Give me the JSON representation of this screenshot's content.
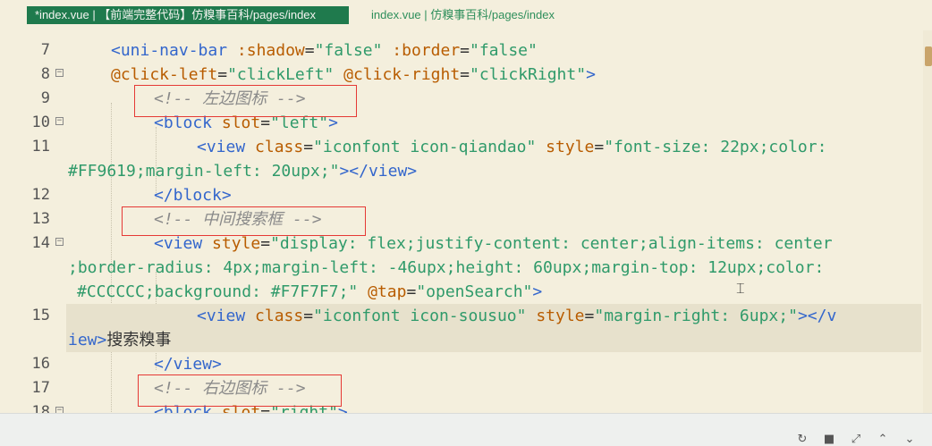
{
  "tabs": [
    {
      "label": "*index.vue | 【前端完整代码】仿糗事百科/pages/index",
      "active": true
    },
    {
      "label": "index.vue | 仿糗事百科/pages/index",
      "active": false
    }
  ],
  "editor": {
    "lines": [
      {
        "num": "7",
        "fold": false,
        "segments": [
          [
            "t",
            "<uni-nav-bar "
          ],
          [
            "a",
            ":shadow"
          ],
          [
            "p",
            "="
          ],
          [
            "s",
            "\"false\""
          ],
          [
            "p",
            " "
          ],
          [
            "a",
            ":border"
          ],
          [
            "p",
            "="
          ],
          [
            "s",
            "\"false\""
          ]
        ]
      },
      {
        "num": "8",
        "fold": true,
        "segments": [
          [
            "a",
            "@click-left"
          ],
          [
            "p",
            "="
          ],
          [
            "s",
            "\"clickLeft\""
          ],
          [
            "p",
            " "
          ],
          [
            "a",
            "@click-right"
          ],
          [
            "p",
            "="
          ],
          [
            "s",
            "\"clickRight\""
          ],
          [
            "t",
            ">"
          ]
        ]
      },
      {
        "num": "9",
        "fold": false,
        "segments": [
          [
            "c",
            "<!-- 左边图标 -->"
          ]
        ]
      },
      {
        "num": "10",
        "fold": true,
        "segments": [
          [
            "t",
            "<block "
          ],
          [
            "a",
            "slot"
          ],
          [
            "p",
            "="
          ],
          [
            "s",
            "\"left\""
          ],
          [
            "t",
            ">"
          ]
        ]
      },
      {
        "num": "11",
        "fold": false,
        "segments": [
          [
            "t",
            "<view "
          ],
          [
            "a",
            "class"
          ],
          [
            "p",
            "="
          ],
          [
            "s",
            "\"iconfont icon-qiandao\""
          ],
          [
            "p",
            " "
          ],
          [
            "a",
            "style"
          ],
          [
            "p",
            "="
          ],
          [
            "s",
            "\"font-size: 22px;color:"
          ]
        ]
      },
      {
        "num": "",
        "fold": false,
        "segments": [
          [
            "s",
            "#FF9619;margin-left: 20upx;\""
          ],
          [
            "t",
            "></view>"
          ]
        ]
      },
      {
        "num": "12",
        "fold": false,
        "segments": [
          [
            "t",
            "</block>"
          ]
        ]
      },
      {
        "num": "13",
        "fold": false,
        "segments": [
          [
            "c",
            "<!-- 中间搜索框 -->"
          ]
        ]
      },
      {
        "num": "14",
        "fold": true,
        "segments": [
          [
            "t",
            "<view "
          ],
          [
            "a",
            "style"
          ],
          [
            "p",
            "="
          ],
          [
            "s",
            "\"display: flex;justify-content: center;align-items: center"
          ]
        ]
      },
      {
        "num": "",
        "fold": false,
        "segments": [
          [
            "s",
            ";border-radius: 4px;margin-left: -46upx;height: 60upx;margin-top: 12upx;color:"
          ]
        ]
      },
      {
        "num": "",
        "fold": false,
        "segments": [
          [
            "s",
            "#CCCCCC;background: #F7F7F7;\""
          ],
          [
            "p",
            " "
          ],
          [
            "a",
            "@tap"
          ],
          [
            "p",
            "="
          ],
          [
            "s",
            "\"openSearch\""
          ],
          [
            "t",
            ">"
          ]
        ]
      },
      {
        "num": "15",
        "fold": false,
        "segments": [
          [
            "t",
            "<view "
          ],
          [
            "a",
            "class"
          ],
          [
            "p",
            "="
          ],
          [
            "s",
            "\"iconfont icon-sousuo\""
          ],
          [
            "p",
            " "
          ],
          [
            "a",
            "style"
          ],
          [
            "p",
            "="
          ],
          [
            "s",
            "\"margin-right: 6upx;\""
          ],
          [
            "t",
            "></v"
          ]
        ]
      },
      {
        "num": "",
        "fold": false,
        "segments": [
          [
            "t",
            "iew>"
          ],
          [
            "x",
            "搜索糗事"
          ]
        ]
      },
      {
        "num": "16",
        "fold": false,
        "segments": [
          [
            "t",
            "</view>"
          ]
        ]
      },
      {
        "num": "17",
        "fold": false,
        "segments": [
          [
            "c",
            "<!-- 右边图标 -->"
          ]
        ]
      },
      {
        "num": "18",
        "fold": false,
        "segments": [
          [
            "t",
            "<block "
          ],
          [
            "a",
            "slot"
          ],
          [
            "p",
            "="
          ],
          [
            "s",
            "\"right\""
          ],
          [
            "t",
            ">"
          ]
        ]
      }
    ]
  },
  "status_icons": [
    "refresh-icon",
    "stop-icon",
    "expand-icon",
    "chevron-up-icon",
    "chevron-down-icon"
  ]
}
